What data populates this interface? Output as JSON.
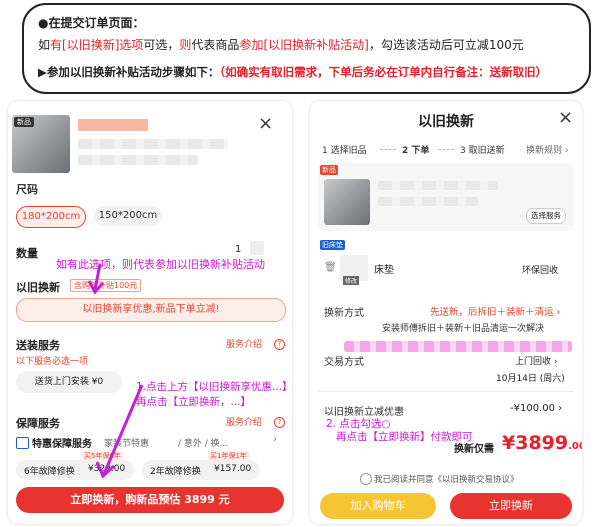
{
  "top_box": {
    "line1": "●在提交订单页面：",
    "line2_parts": [
      "如",
      "有[以旧换新]选项",
      "可选，",
      "则",
      "代表商品",
      "参加[以旧换新补贴活动]",
      "，勾选该活动后可立减100元"
    ],
    "line3_parts": [
      "▶参加以旧换新补贴活动步骤如下：",
      "（如确实有取旧需求，下单后务必在订单内自行备注：送新取旧）"
    ]
  },
  "left": {
    "badge": "新品",
    "cut_text": "尺码",
    "size_options": [
      "180*200cm",
      "150*200cm"
    ],
    "quantity_label": "数量",
    "quantity_value": "1",
    "annotation1": "如有此选项，则代表参加以旧换新补贴活动",
    "tradein_label": "以旧换新",
    "tradein_chip": "含购新补贴100元",
    "tradein_banner": "以旧换新享优惠,新品下单立减!",
    "delivery_label": "送装服务",
    "delivery_intro": "服务介绍",
    "delivery_sub": "以下服务必选一项",
    "delivery_option": "送货上门安装 ¥0",
    "annotation2_line1": "1.点击上方【以旧换新享优惠...】",
    "annotation2_line2": "再点击【立即换新，...】",
    "protection_label": "保障服务",
    "protection_intro": "服务介绍",
    "special_protection": "特惠保障服务",
    "special_protection_sub": "家装节特惠",
    "special_protection_sub2": "/ 意外 / 换...",
    "plan1_badge": "买5年保6年",
    "plan1_label": "6年故障修换",
    "plan1_price": "¥329.00",
    "plan2_badge": "买1年保1年",
    "plan2_label": "2年故障修换",
    "plan2_price": "¥157.00",
    "bottom_button": "立即换新，购新品预估 3899 元",
    "close_symbol": "×"
  },
  "right": {
    "title": "以旧换新",
    "close_symbol": "×",
    "step1": "1 选择旧品",
    "step2": "2 下单",
    "step3": "3 取旧送新",
    "rules": "换新规则 ›",
    "new_badge": "新品",
    "select_service": "选择服务",
    "old_badge": "旧床垫",
    "old_item_name": "床垫",
    "old_item_tag": "修改",
    "recycle": "环保回收",
    "tradein_method_label": "换新方式",
    "tradein_method_value": "先送新，后拆旧＋装新＋清运 ›",
    "tradein_method_desc": "安装师傅拆旧＋装新＋旧品清运一次解决",
    "pickup_label": "交易方式",
    "pickup_value": "上门回收 ›",
    "pickup_date": "10月14日 (周六)",
    "discount_label": "以旧换新立减优惠",
    "discount_value": "-¥100.00 ›",
    "annotation3_line1": "2. 点击勾选○",
    "annotation3_line2": "再点击【立即换新】付款即可",
    "price_label": "换新仅需",
    "price_value": "¥3899",
    "price_decimal": ".00",
    "agreement": "我已阅读并同意《以旧换新交易协议》",
    "add_cart": "加入购物车",
    "buy_now": "立即换新"
  },
  "colors": {
    "red": "#e8202a",
    "annotation": "#d113d9",
    "button_red": "#e8332e",
    "button_yellow": "#f6c536"
  }
}
